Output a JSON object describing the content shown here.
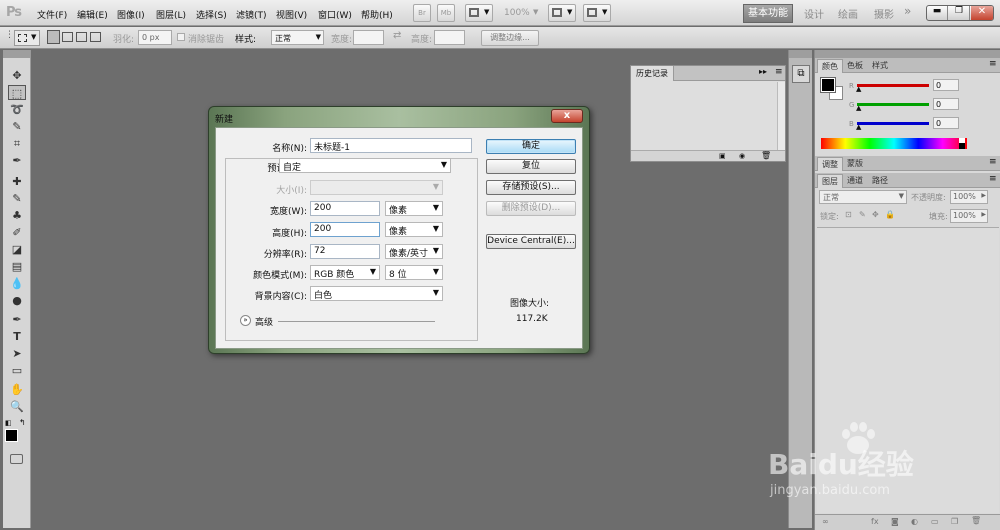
{
  "app": {
    "logo": "Ps"
  },
  "menu": [
    "文件(F)",
    "编辑(E)",
    "图像(I)",
    "图层(L)",
    "选择(S)",
    "滤镜(T)",
    "视图(V)",
    "窗口(W)",
    "帮助(H)"
  ],
  "menubar_controls": {
    "br_label": "Br",
    "mb_label": "Mb",
    "zoom": "100%"
  },
  "workspaces": {
    "active": "基本功能",
    "design": "设计",
    "paint": "绘画",
    "photo": "摄影",
    "more": "»"
  },
  "options_bar": {
    "feather_label": "羽化:",
    "feather_value": "0 px",
    "antialias_label": "消除锯齿",
    "style_label": "样式:",
    "style_value": "正常",
    "width_label": "宽度:",
    "height_label": "高度:",
    "refine_button": "调整边缘..."
  },
  "history_panel": {
    "tab": "历史记录"
  },
  "color_panel": {
    "tabs": [
      "颜色",
      "色板",
      "样式"
    ],
    "channels": [
      {
        "name": "R",
        "value": "0",
        "color": "#cc0000"
      },
      {
        "name": "G",
        "value": "0",
        "color": "#00a000"
      },
      {
        "name": "B",
        "value": "0",
        "color": "#0000cc"
      }
    ]
  },
  "adjust_panel": {
    "tabs": [
      "调整",
      "蒙版"
    ]
  },
  "layers_panel": {
    "tabs": [
      "图层",
      "通道",
      "路径"
    ],
    "blend_mode": "正常",
    "opacity_label": "不透明度:",
    "opacity_value": "100%",
    "lock_label": "锁定:",
    "fill_label": "填充:",
    "fill_value": "100%"
  },
  "dialog": {
    "title": "新建",
    "close": "x",
    "name_label": "名称(N):",
    "name_value": "未标题-1",
    "preset_label": "预设(P):",
    "preset_value": "自定",
    "size_label": "大小(I):",
    "width_label": "宽度(W):",
    "width_value": "200",
    "width_unit": "像素",
    "height_label": "高度(H):",
    "height_value": "200",
    "height_unit": "像素",
    "resolution_label": "分辨率(R):",
    "resolution_value": "72",
    "resolution_unit": "像素/英寸",
    "colormode_label": "颜色模式(M):",
    "colormode_value": "RGB 颜色",
    "bitdepth_value": "8 位",
    "background_label": "背景内容(C):",
    "background_value": "白色",
    "advanced_label": "高级",
    "buttons": {
      "ok": "确定",
      "reset": "复位",
      "save_preset": "存储预设(S)...",
      "delete_preset": "删除预设(D)...",
      "device_central": "Device Central(E)..."
    },
    "image_size_label": "图像大小:",
    "image_size_value": "117.2K"
  },
  "watermark": {
    "brand": "Baidu经验",
    "url": "jingyan.baidu.com"
  }
}
